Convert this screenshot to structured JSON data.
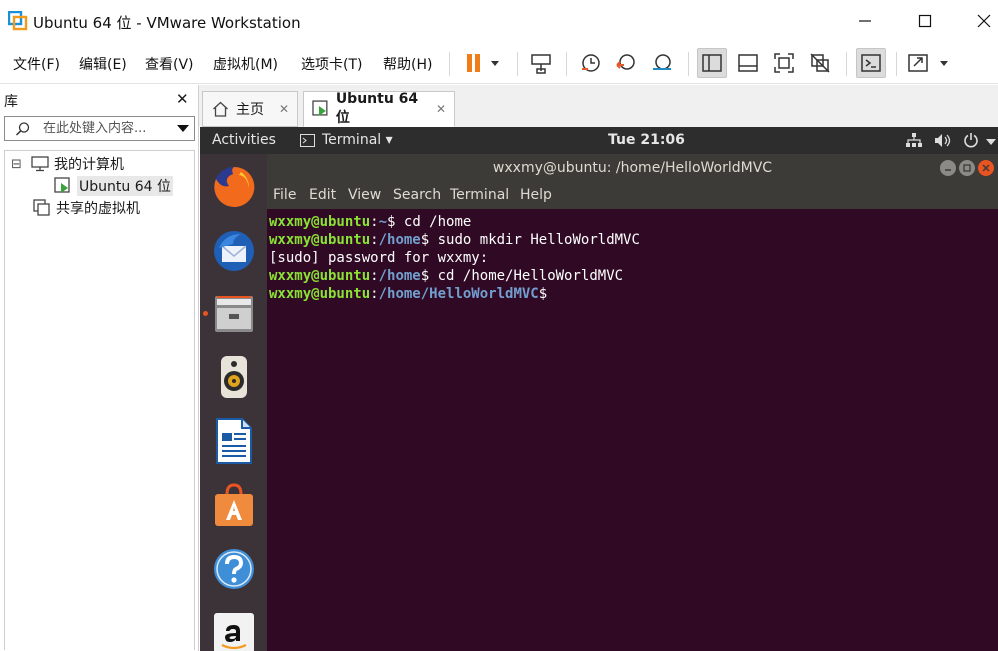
{
  "window": {
    "title": "Ubuntu 64 位 - VMware Workstation",
    "minimize": "—",
    "maximize": "☐",
    "close": "✕"
  },
  "menu": {
    "items": [
      "文件(F)",
      "编辑(E)",
      "查看(V)",
      "虚拟机(M)",
      "选项卡(T)",
      "帮助(H)"
    ]
  },
  "library": {
    "title": "库",
    "close": "✕",
    "search_placeholder": "在此处键入内容...",
    "tree": {
      "my_computer": "我的计算机",
      "vm": "Ubuntu 64 位",
      "shared": "共享的虚拟机",
      "collapse": "⊟"
    }
  },
  "tabs": [
    {
      "label": "主页",
      "close": "✕"
    },
    {
      "label": "Ubuntu 64 位",
      "close": "✕"
    }
  ],
  "ubuntu": {
    "activities": "Activities",
    "app_menu": "Terminal ▾",
    "clock": "Tue 21:06",
    "dock": [
      "firefox-icon",
      "thunderbird-icon",
      "files-icon",
      "rhythmbox-icon",
      "writer-icon",
      "software-icon",
      "help-icon",
      "amazon-icon"
    ]
  },
  "terminal": {
    "title": "wxxmy@ubuntu: /home/HelloWorldMVC",
    "menu": [
      "File",
      "Edit",
      "View",
      "Search",
      "Terminal",
      "Help"
    ],
    "lines": [
      {
        "user": "wxxmy@ubuntu",
        "path": "~",
        "cmd": " cd /home"
      },
      {
        "user": "wxxmy@ubuntu",
        "path": "/home",
        "cmd": " sudo mkdir HelloWorldMVC"
      },
      {
        "text": "[sudo] password for wxxmy:"
      },
      {
        "user": "wxxmy@ubuntu",
        "path": "/home",
        "cmd": " cd /home/HelloWorldMVC"
      },
      {
        "user": "wxxmy@ubuntu",
        "path": "/home/HelloWorldMVC",
        "cmd": ""
      }
    ]
  },
  "colors": {
    "terminal_bg": "#300a24",
    "prompt_user": "#8ae234",
    "prompt_path": "#729fcf",
    "accent_orange": "#e95420"
  }
}
